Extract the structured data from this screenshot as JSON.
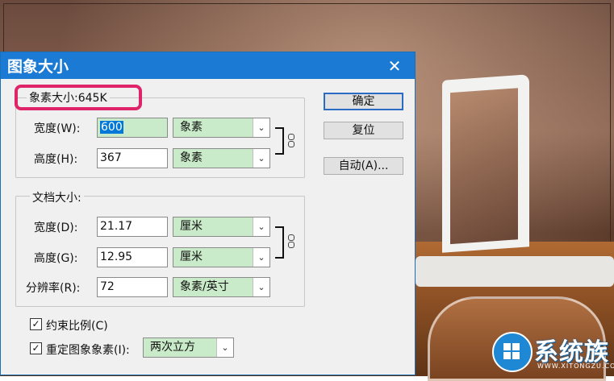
{
  "dialog": {
    "title": "图象大小",
    "close_glyph": "✕",
    "pixel_dimensions": {
      "legend": "象素大小:645K",
      "width_label": "宽度(W):",
      "width_value": "600",
      "width_unit": "象素",
      "height_label": "高度(H):",
      "height_value": "367",
      "height_unit": "象素"
    },
    "document_size": {
      "legend": "文档大小:",
      "width_label": "宽度(D):",
      "width_value": "21.17",
      "width_unit": "厘米",
      "height_label": "高度(G):",
      "height_value": "12.95",
      "height_unit": "厘米",
      "resolution_label": "分辨率(R):",
      "resolution_value": "72",
      "resolution_unit": "象素/英寸"
    },
    "buttons": {
      "ok": "确定",
      "reset": "复位",
      "auto": "自动(A)..."
    },
    "constrain": {
      "label": "约束比例(C)",
      "checked": true
    },
    "resample": {
      "label": "重定图象象素(I):",
      "checked": true,
      "method": "两次立方"
    },
    "chevron": "⌄",
    "check_glyph": "✓"
  },
  "watermark": {
    "text": "系统族",
    "sub": "WWW.XITONGZU.COM"
  },
  "colors": {
    "titlebar": "#1a7ad4",
    "highlight": "#e0246a",
    "select_bg": "#c9ebc9"
  }
}
